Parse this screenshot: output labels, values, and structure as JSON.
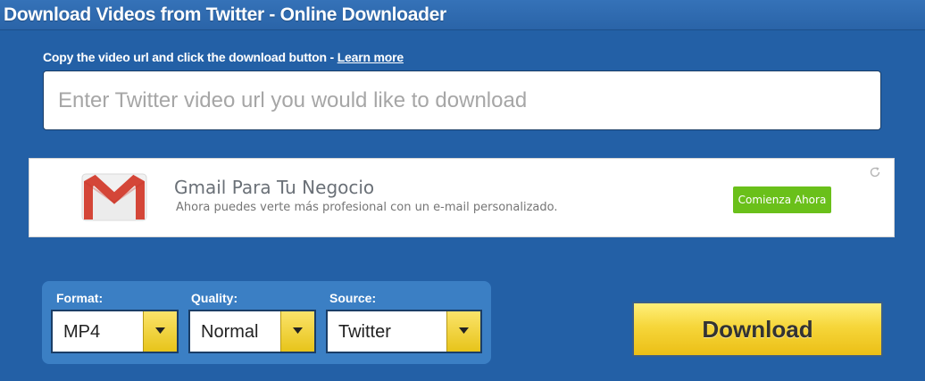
{
  "header": {
    "title": "Download Videos from Twitter - Online Downloader"
  },
  "instruction": {
    "text": "Copy the video url and click the download button - ",
    "link": "Learn more"
  },
  "url_input": {
    "placeholder": "Enter Twitter video url you would like to download",
    "value": ""
  },
  "ad": {
    "logo_icon": "gmail-icon",
    "title": "Gmail Para Tu Negocio",
    "description": "Ahora puedes verte más profesional con un e-mail personalizado.",
    "cta": "Comienza Ahora",
    "refresh_icon": "refresh-icon",
    "cta_color": "#6ac01a"
  },
  "options": {
    "format": {
      "label": "Format:",
      "value": "MP4"
    },
    "quality": {
      "label": "Quality:",
      "value": "Normal"
    },
    "source": {
      "label": "Source:",
      "value": "Twitter"
    }
  },
  "download_button": {
    "label": "Download"
  },
  "colors": {
    "background": "#2360a6",
    "panel": "#3b7fc4",
    "accent_yellow": "#f6d63a"
  }
}
